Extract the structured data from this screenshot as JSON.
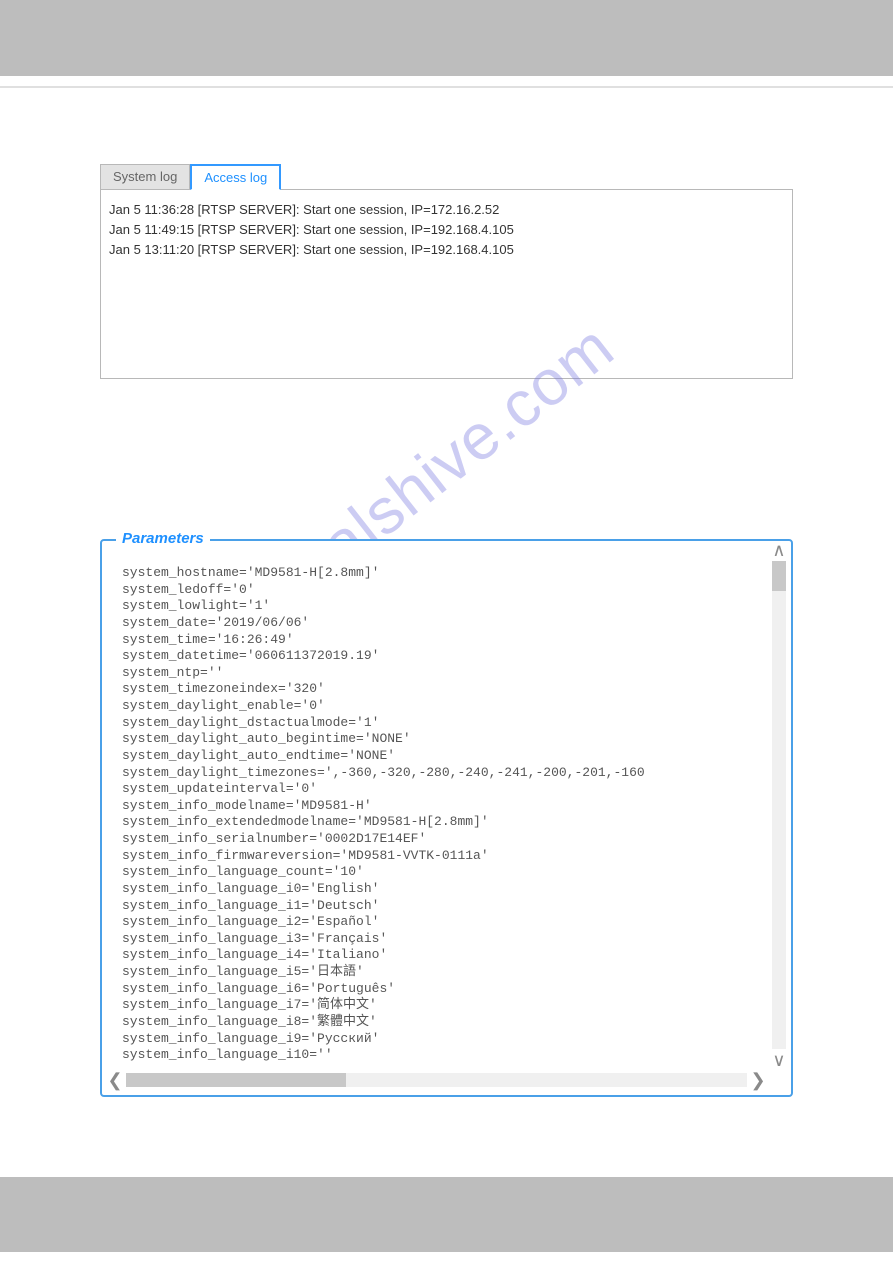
{
  "watermark": "ualshive.com",
  "tabs": {
    "system": "System log",
    "access": "Access log"
  },
  "log_entries": [
    "Jan 5 11:36:28 [RTSP SERVER]: Start one session, IP=172.16.2.52",
    "Jan 5 11:49:15 [RTSP SERVER]: Start one session, IP=192.168.4.105",
    "Jan 5 13:11:20 [RTSP SERVER]: Start one session, IP=192.168.4.105"
  ],
  "params_title": "Parameters",
  "parameters": [
    "system_hostname='MD9581-H[2.8mm]'",
    "system_ledoff='0'",
    "system_lowlight='1'",
    "system_date='2019/06/06'",
    "system_time='16:26:49'",
    "system_datetime='060611372019.19'",
    "system_ntp=''",
    "system_timezoneindex='320'",
    "system_daylight_enable='0'",
    "system_daylight_dstactualmode='1'",
    "system_daylight_auto_begintime='NONE'",
    "system_daylight_auto_endtime='NONE'",
    "system_daylight_timezones=',-360,-320,-280,-240,-241,-200,-201,-160",
    "system_updateinterval='0'",
    "system_info_modelname='MD9581-H'",
    "system_info_extendedmodelname='MD9581-H[2.8mm]'",
    "system_info_serialnumber='0002D17E14EF'",
    "system_info_firmwareversion='MD9581-VVTK-0111a'",
    "system_info_language_count='10'",
    "system_info_language_i0='English'",
    "system_info_language_i1='Deutsch'",
    "system_info_language_i2='Español'",
    "system_info_language_i3='Français'",
    "system_info_language_i4='Italiano'",
    "system_info_language_i5='日本語'",
    "system_info_language_i6='Português'",
    "system_info_language_i7='简体中文'",
    "system_info_language_i8='繁體中文'",
    "system_info_language_i9='Русский'",
    "system_info_language_i10=''"
  ],
  "arrows": {
    "up": "∧",
    "down": "∨",
    "left": "❮",
    "right": "❯"
  }
}
